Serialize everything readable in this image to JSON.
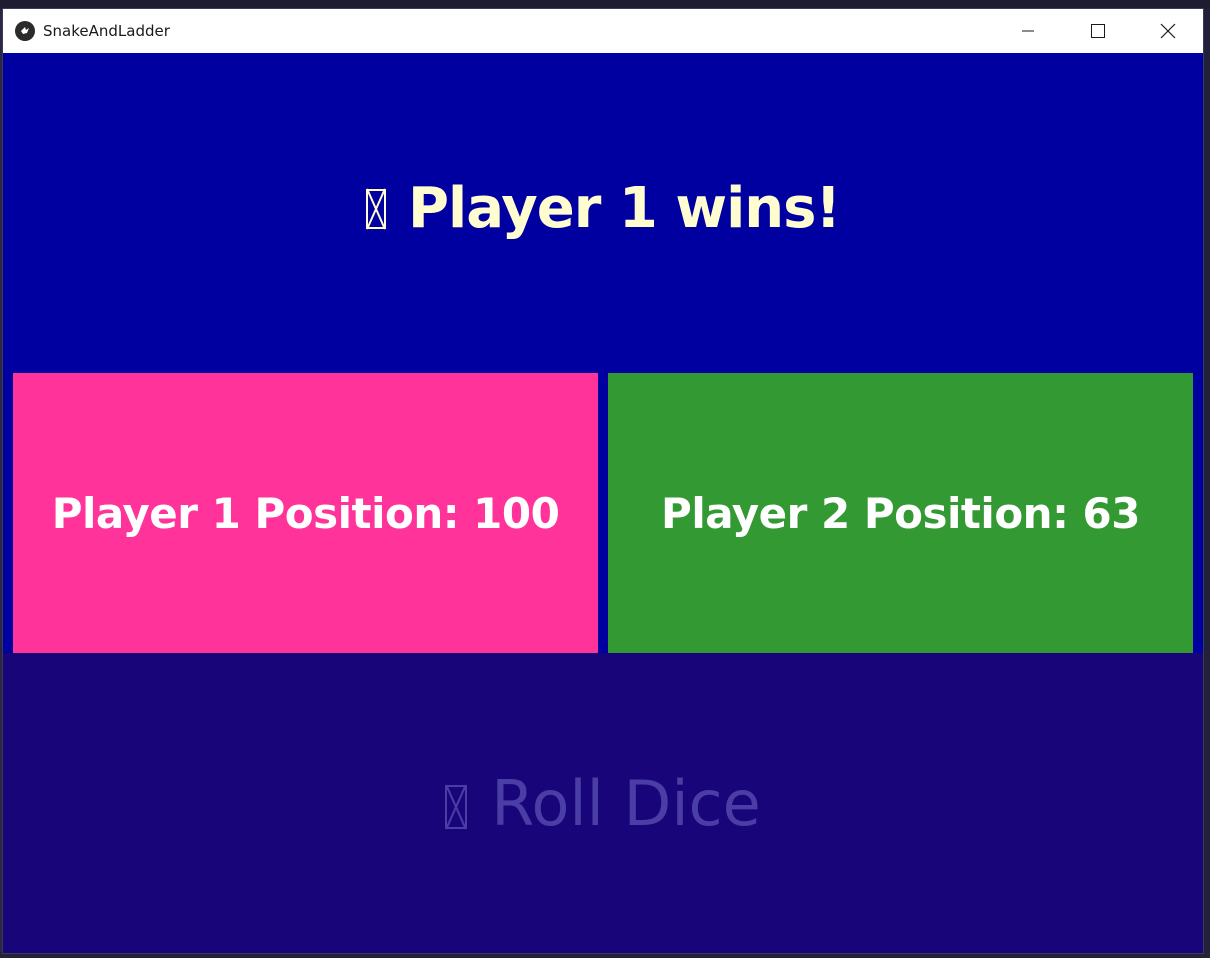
{
  "window": {
    "title": "SnakeAndLadder",
    "icon": "kivy-app-icon",
    "controls": [
      "minimize-icon",
      "maximize-icon",
      "close-icon"
    ]
  },
  "status": {
    "icon": "missing-glyph-icon",
    "text": "Player 1 wins!",
    "color": "#fffccf"
  },
  "players": [
    {
      "label": "Player 1 Position: 100",
      "color": "#ff3399"
    },
    {
      "label": "Player 2 Position: 63",
      "color": "#339933"
    }
  ],
  "roll_button": {
    "icon": "missing-glyph-icon",
    "label": "Roll Dice",
    "state": "disabled"
  },
  "colors": {
    "background": "#0000a0",
    "roll_button_bg": "#19057a",
    "roll_button_text": "#4b3da6"
  }
}
